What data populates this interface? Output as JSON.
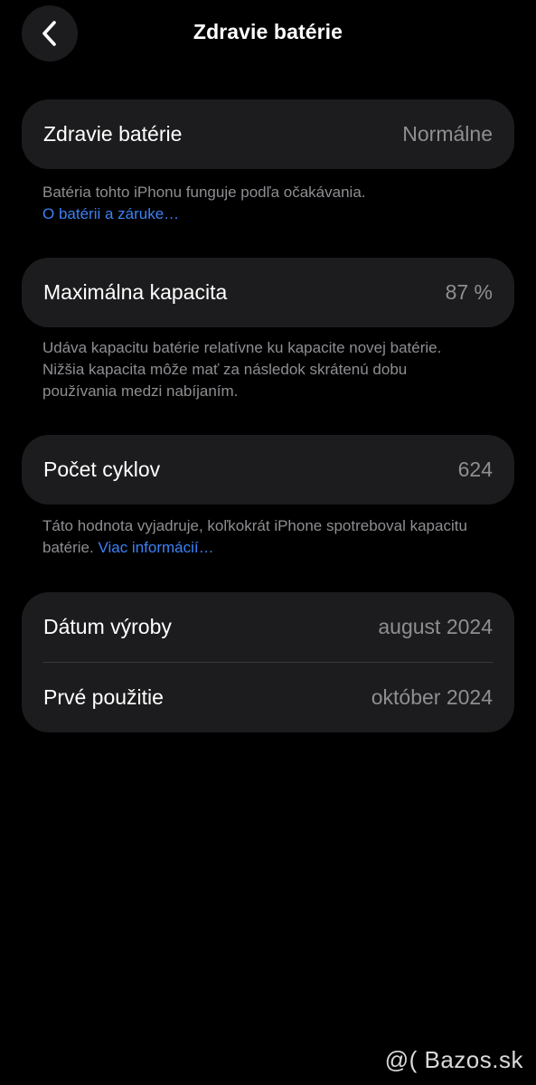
{
  "nav": {
    "title": "Zdravie batérie"
  },
  "health": {
    "label": "Zdravie batérie",
    "value": "Normálne",
    "note": "Batéria tohto iPhonu funguje podľa očakávania.",
    "link": "O batérii a záruke…"
  },
  "capacity": {
    "label": "Maximálna kapacita",
    "value": "87 %",
    "note": "Udáva kapacitu batérie relatívne ku kapacite novej batérie. Nižšia kapacita môže mať za následok skrátenú dobu používania medzi nabíjaním."
  },
  "cycles": {
    "label": "Počet cyklov",
    "value": "624",
    "note": "Táto hodnota vyjadruje, koľkokrát iPhone spotreboval kapacitu batérie.",
    "link": "Viac informácií…"
  },
  "dates": {
    "manufacture_label": "Dátum výroby",
    "manufacture_value": "august 2024",
    "first_use_label": "Prvé použitie",
    "first_use_value": "október 2024"
  },
  "watermark": "@( Bazos.sk",
  "colors": {
    "background": "#000000",
    "card": "#1c1c1e",
    "secondary_text": "#8e8e93",
    "link": "#3b82f6"
  }
}
